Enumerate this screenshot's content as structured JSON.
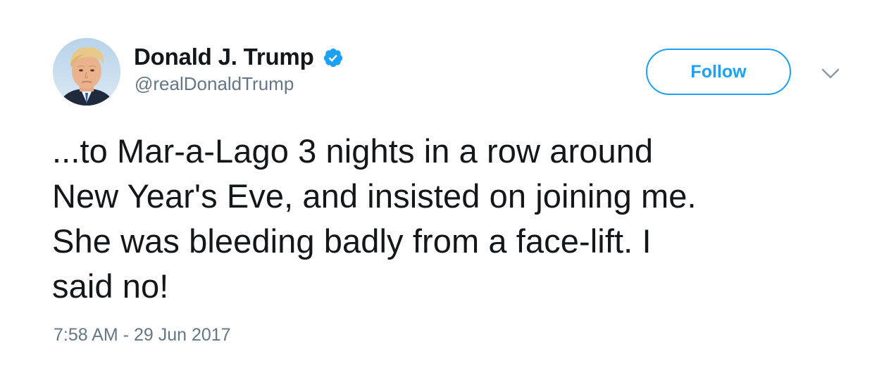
{
  "user": {
    "display_name": "Donald J. Trump",
    "screen_name": "@realDonaldTrump",
    "verified": true,
    "verified_icon": "verified-badge-icon",
    "avatar": "profile-avatar"
  },
  "actions": {
    "follow_label": "Follow",
    "more_icon": "chevron-down-icon"
  },
  "tweet": {
    "lines": [
      "...to Mar-a-Lago 3 nights in a row around",
      "New Year's Eve, and insisted on joining me.",
      "She was bleeding badly from a face-lift. I",
      "said no!"
    ],
    "timestamp": "7:58 AM - 29 Jun 2017"
  },
  "colors": {
    "accent": "#1da1f2",
    "text": "#14171a",
    "secondary_text": "#657786",
    "background": "#ffffff"
  }
}
